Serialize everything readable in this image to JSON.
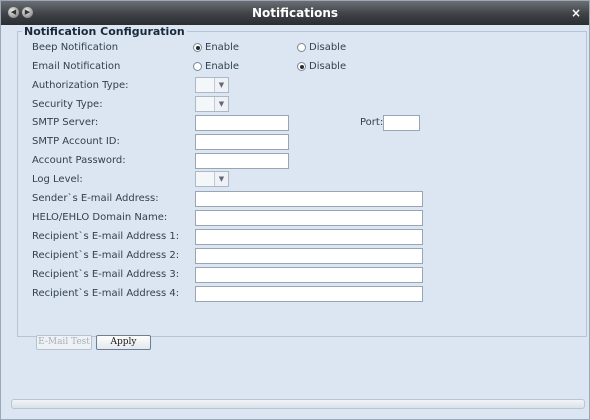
{
  "window": {
    "title": "Notifications",
    "close": "×"
  },
  "group": {
    "title": "Notification Configuration"
  },
  "beep": {
    "label": "Beep Notification",
    "enable": "Enable",
    "disable": "Disable",
    "selected": "Enable"
  },
  "email": {
    "label": "Email Notification",
    "enable": "Enable",
    "disable": "Disable",
    "selected": "Disable"
  },
  "auth_type": {
    "label": "Authorization Type:",
    "value": ""
  },
  "security_type": {
    "label": "Security Type:",
    "value": ""
  },
  "smtp_server": {
    "label": "SMTP Server:",
    "value": "",
    "port_label": "Port:",
    "port_value": ""
  },
  "smtp_account": {
    "label": "SMTP Account ID:",
    "value": ""
  },
  "account_password": {
    "label": "Account Password:",
    "value": ""
  },
  "log_level": {
    "label": "Log Level:",
    "value": ""
  },
  "sender": {
    "label": "Sender`s E-mail Address:",
    "value": ""
  },
  "helo": {
    "label": "HELO/EHLO Domain Name:",
    "value": ""
  },
  "recipients": [
    {
      "label": "Recipient`s E-mail Address 1:",
      "value": ""
    },
    {
      "label": "Recipient`s E-mail Address 2:",
      "value": ""
    },
    {
      "label": "Recipient`s E-mail Address 3:",
      "value": ""
    },
    {
      "label": "Recipient`s E-mail Address 4:",
      "value": ""
    }
  ],
  "buttons": {
    "email_test": "E-Mail Test",
    "apply": "Apply"
  }
}
